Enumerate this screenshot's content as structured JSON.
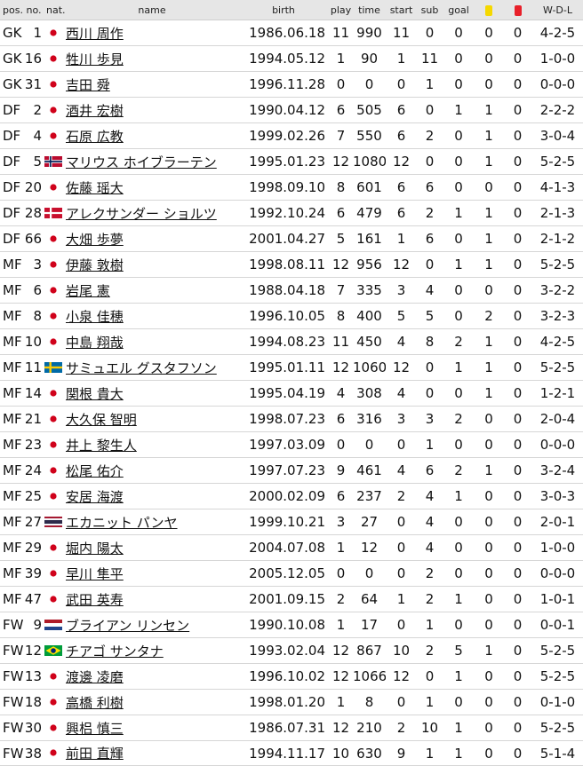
{
  "headers": {
    "pos": "pos.",
    "no": "no.",
    "nat": "nat.",
    "name": "name",
    "birth": "birth",
    "play": "play",
    "time": "time",
    "start": "start",
    "sub": "sub",
    "goal": "goal",
    "wdl": "W-D-L"
  },
  "card_colors": {
    "yellow": "#f5d800",
    "red": "#e8202a"
  },
  "players": [
    {
      "pos": "GK",
      "no": "1",
      "flag": "jp",
      "name": "西川 周作",
      "birth": "1986.06.18",
      "play": "11",
      "time": "990",
      "start": "11",
      "sub": "0",
      "goal": "0",
      "yellow": "0",
      "red": "0",
      "wdl": "4-2-5"
    },
    {
      "pos": "GK",
      "no": "16",
      "flag": "jp",
      "name": "牲川 歩見",
      "birth": "1994.05.12",
      "play": "1",
      "time": "90",
      "start": "1",
      "sub": "11",
      "goal": "0",
      "yellow": "0",
      "red": "0",
      "wdl": "1-0-0"
    },
    {
      "pos": "GK",
      "no": "31",
      "flag": "jp",
      "name": "吉田 舜",
      "birth": "1996.11.28",
      "play": "0",
      "time": "0",
      "start": "0",
      "sub": "1",
      "goal": "0",
      "yellow": "0",
      "red": "0",
      "wdl": "0-0-0"
    },
    {
      "pos": "DF",
      "no": "2",
      "flag": "jp",
      "name": "酒井 宏樹",
      "birth": "1990.04.12",
      "play": "6",
      "time": "505",
      "start": "6",
      "sub": "0",
      "goal": "1",
      "yellow": "1",
      "red": "0",
      "wdl": "2-2-2"
    },
    {
      "pos": "DF",
      "no": "4",
      "flag": "jp",
      "name": "石原 広教",
      "birth": "1999.02.26",
      "play": "7",
      "time": "550",
      "start": "6",
      "sub": "2",
      "goal": "0",
      "yellow": "1",
      "red": "0",
      "wdl": "3-0-4"
    },
    {
      "pos": "DF",
      "no": "5",
      "flag": "no",
      "name": "マリウス ホイブラーテン",
      "birth": "1995.01.23",
      "play": "12",
      "time": "1080",
      "start": "12",
      "sub": "0",
      "goal": "0",
      "yellow": "1",
      "red": "0",
      "wdl": "5-2-5"
    },
    {
      "pos": "DF",
      "no": "20",
      "flag": "jp",
      "name": "佐藤 瑶大",
      "birth": "1998.09.10",
      "play": "8",
      "time": "601",
      "start": "6",
      "sub": "6",
      "goal": "0",
      "yellow": "0",
      "red": "0",
      "wdl": "4-1-3"
    },
    {
      "pos": "DF",
      "no": "28",
      "flag": "dk",
      "name": "アレクサンダー ショルツ",
      "birth": "1992.10.24",
      "play": "6",
      "time": "479",
      "start": "6",
      "sub": "2",
      "goal": "1",
      "yellow": "1",
      "red": "0",
      "wdl": "2-1-3"
    },
    {
      "pos": "DF",
      "no": "66",
      "flag": "jp",
      "name": "大畑 歩夢",
      "birth": "2001.04.27",
      "play": "5",
      "time": "161",
      "start": "1",
      "sub": "6",
      "goal": "0",
      "yellow": "1",
      "red": "0",
      "wdl": "2-1-2"
    },
    {
      "pos": "MF",
      "no": "3",
      "flag": "jp",
      "name": "伊藤 敦樹",
      "birth": "1998.08.11",
      "play": "12",
      "time": "956",
      "start": "12",
      "sub": "0",
      "goal": "1",
      "yellow": "1",
      "red": "0",
      "wdl": "5-2-5"
    },
    {
      "pos": "MF",
      "no": "6",
      "flag": "jp",
      "name": "岩尾 憲",
      "birth": "1988.04.18",
      "play": "7",
      "time": "335",
      "start": "3",
      "sub": "4",
      "goal": "0",
      "yellow": "0",
      "red": "0",
      "wdl": "3-2-2"
    },
    {
      "pos": "MF",
      "no": "8",
      "flag": "jp",
      "name": "小泉 佳穂",
      "birth": "1996.10.05",
      "play": "8",
      "time": "400",
      "start": "5",
      "sub": "5",
      "goal": "0",
      "yellow": "2",
      "red": "0",
      "wdl": "3-2-3"
    },
    {
      "pos": "MF",
      "no": "10",
      "flag": "jp",
      "name": "中島 翔哉",
      "birth": "1994.08.23",
      "play": "11",
      "time": "450",
      "start": "4",
      "sub": "8",
      "goal": "2",
      "yellow": "1",
      "red": "0",
      "wdl": "4-2-5"
    },
    {
      "pos": "MF",
      "no": "11",
      "flag": "se",
      "name": "サミュエル グスタフソン",
      "birth": "1995.01.11",
      "play": "12",
      "time": "1060",
      "start": "12",
      "sub": "0",
      "goal": "1",
      "yellow": "1",
      "red": "0",
      "wdl": "5-2-5"
    },
    {
      "pos": "MF",
      "no": "14",
      "flag": "jp",
      "name": "関根 貴大",
      "birth": "1995.04.19",
      "play": "4",
      "time": "308",
      "start": "4",
      "sub": "0",
      "goal": "0",
      "yellow": "1",
      "red": "0",
      "wdl": "1-2-1"
    },
    {
      "pos": "MF",
      "no": "21",
      "flag": "jp",
      "name": "大久保 智明",
      "birth": "1998.07.23",
      "play": "6",
      "time": "316",
      "start": "3",
      "sub": "3",
      "goal": "2",
      "yellow": "0",
      "red": "0",
      "wdl": "2-0-4"
    },
    {
      "pos": "MF",
      "no": "23",
      "flag": "jp",
      "name": "井上 黎生人",
      "birth": "1997.03.09",
      "play": "0",
      "time": "0",
      "start": "0",
      "sub": "1",
      "goal": "0",
      "yellow": "0",
      "red": "0",
      "wdl": "0-0-0"
    },
    {
      "pos": "MF",
      "no": "24",
      "flag": "jp",
      "name": "松尾 佑介",
      "birth": "1997.07.23",
      "play": "9",
      "time": "461",
      "start": "4",
      "sub": "6",
      "goal": "2",
      "yellow": "1",
      "red": "0",
      "wdl": "3-2-4"
    },
    {
      "pos": "MF",
      "no": "25",
      "flag": "jp",
      "name": "安居 海渡",
      "birth": "2000.02.09",
      "play": "6",
      "time": "237",
      "start": "2",
      "sub": "4",
      "goal": "1",
      "yellow": "0",
      "red": "0",
      "wdl": "3-0-3"
    },
    {
      "pos": "MF",
      "no": "27",
      "flag": "th",
      "name": "エカニット パンヤ",
      "birth": "1999.10.21",
      "play": "3",
      "time": "27",
      "start": "0",
      "sub": "4",
      "goal": "0",
      "yellow": "0",
      "red": "0",
      "wdl": "2-0-1"
    },
    {
      "pos": "MF",
      "no": "29",
      "flag": "jp",
      "name": "堀内 陽太",
      "birth": "2004.07.08",
      "play": "1",
      "time": "12",
      "start": "0",
      "sub": "4",
      "goal": "0",
      "yellow": "0",
      "red": "0",
      "wdl": "1-0-0"
    },
    {
      "pos": "MF",
      "no": "39",
      "flag": "jp",
      "name": "早川 隼平",
      "birth": "2005.12.05",
      "play": "0",
      "time": "0",
      "start": "0",
      "sub": "2",
      "goal": "0",
      "yellow": "0",
      "red": "0",
      "wdl": "0-0-0"
    },
    {
      "pos": "MF",
      "no": "47",
      "flag": "jp",
      "name": "武田 英寿",
      "birth": "2001.09.15",
      "play": "2",
      "time": "64",
      "start": "1",
      "sub": "2",
      "goal": "1",
      "yellow": "0",
      "red": "0",
      "wdl": "1-0-1"
    },
    {
      "pos": "FW",
      "no": "9",
      "flag": "nl",
      "name": "ブライアン リンセン",
      "birth": "1990.10.08",
      "play": "1",
      "time": "17",
      "start": "0",
      "sub": "1",
      "goal": "0",
      "yellow": "0",
      "red": "0",
      "wdl": "0-0-1"
    },
    {
      "pos": "FW",
      "no": "12",
      "flag": "br",
      "name": "チアゴ サンタナ",
      "birth": "1993.02.04",
      "play": "12",
      "time": "867",
      "start": "10",
      "sub": "2",
      "goal": "5",
      "yellow": "1",
      "red": "0",
      "wdl": "5-2-5"
    },
    {
      "pos": "FW",
      "no": "13",
      "flag": "jp",
      "name": "渡邊 凌磨",
      "birth": "1996.10.02",
      "play": "12",
      "time": "1066",
      "start": "12",
      "sub": "0",
      "goal": "1",
      "yellow": "0",
      "red": "0",
      "wdl": "5-2-5"
    },
    {
      "pos": "FW",
      "no": "18",
      "flag": "jp",
      "name": "高橋 利樹",
      "birth": "1998.01.20",
      "play": "1",
      "time": "8",
      "start": "0",
      "sub": "1",
      "goal": "0",
      "yellow": "0",
      "red": "0",
      "wdl": "0-1-0"
    },
    {
      "pos": "FW",
      "no": "30",
      "flag": "jp",
      "name": "興梠 慎三",
      "birth": "1986.07.31",
      "play": "12",
      "time": "210",
      "start": "2",
      "sub": "10",
      "goal": "1",
      "yellow": "0",
      "red": "0",
      "wdl": "5-2-5"
    },
    {
      "pos": "FW",
      "no": "38",
      "flag": "jp",
      "name": "前田 直輝",
      "birth": "1994.11.17",
      "play": "10",
      "time": "630",
      "start": "9",
      "sub": "1",
      "goal": "1",
      "yellow": "0",
      "red": "0",
      "wdl": "5-1-4"
    }
  ]
}
